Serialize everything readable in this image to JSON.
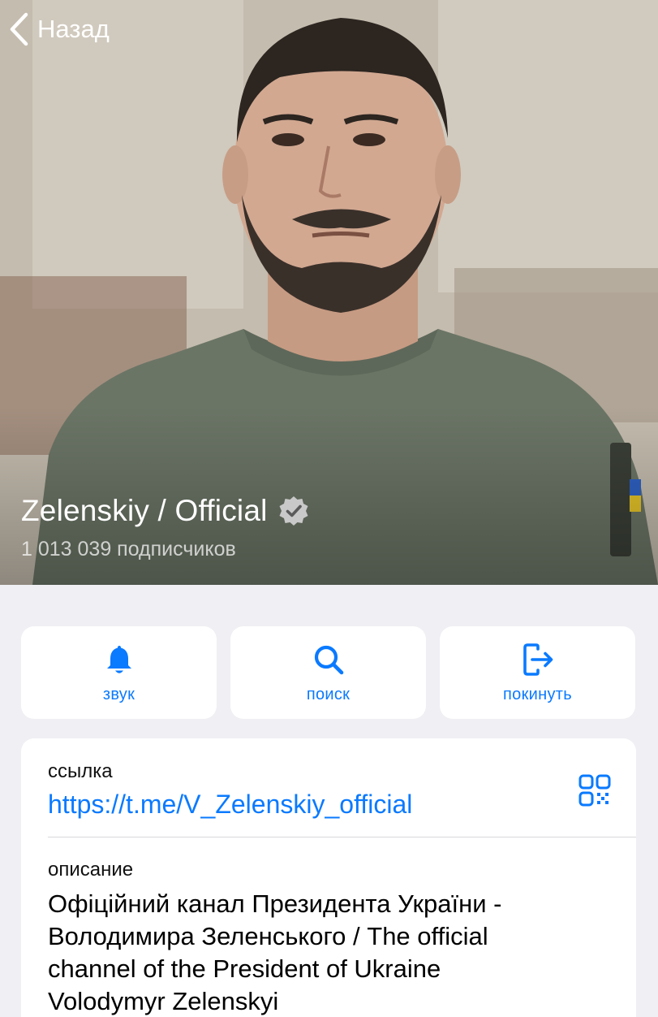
{
  "header": {
    "back_label": "Назад",
    "channel_name": "Zelenskiy / Official",
    "subscribers": "1 013 039 подписчиков",
    "photo": "profile-photo"
  },
  "actions": [
    {
      "label": "звук",
      "icon": "bell-icon"
    },
    {
      "label": "поиск",
      "icon": "search-icon"
    },
    {
      "label": "покинуть",
      "icon": "leave-icon"
    }
  ],
  "info": {
    "link_label": "ссылка",
    "link_value": "https://t.me/V_Zelenskiy_official",
    "description_label": "описание",
    "description_lines": [
      "Офіційний канал Президента України -",
      "Володимира Зеленського / The official",
      "channel of the President of Ukraine",
      "Volodymyr Zelenskyi"
    ]
  },
  "colors": {
    "accent": "#0a7aff",
    "background": "#efeff4",
    "card": "#ffffff"
  }
}
